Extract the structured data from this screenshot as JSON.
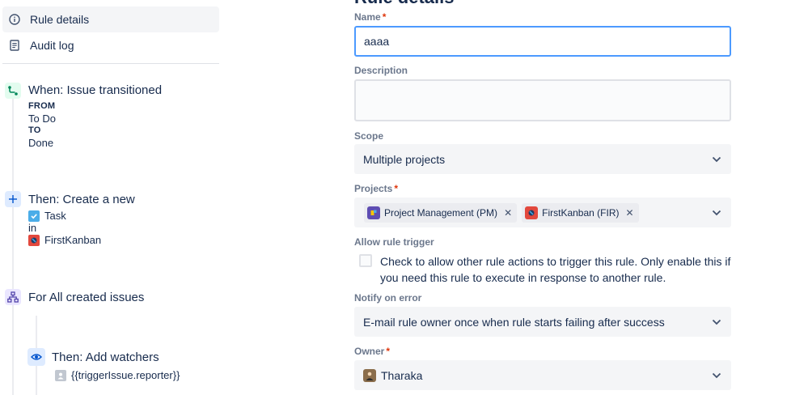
{
  "nav": {
    "items": [
      {
        "label": "Rule details",
        "icon": "info-icon",
        "active": true
      },
      {
        "label": "Audit log",
        "icon": "document-icon",
        "active": false
      }
    ]
  },
  "rule": {
    "trigger": {
      "title": "When: Issue transitioned",
      "from_label": "FROM",
      "from_value": "To Do",
      "to_label": "TO",
      "to_value": "Done",
      "icon": "transition-icon"
    },
    "create": {
      "title": "Then: Create a new",
      "issue_type": "Task",
      "connector": "in",
      "project": "FirstKanban",
      "icon": "plus-icon"
    },
    "branch": {
      "title": "For All created issues",
      "icon": "branch-icon"
    },
    "watchers": {
      "title": "Then: Add watchers",
      "value": "{{triggerIssue.reporter}}",
      "icon": "eye-icon"
    }
  },
  "form": {
    "heading": "Rule details",
    "name_label": "Name",
    "name_value": "aaaa",
    "required_mark": "*",
    "description_label": "Description",
    "description_value": "",
    "scope_label": "Scope",
    "scope_value": "Multiple projects",
    "projects_label": "Projects",
    "projects": [
      {
        "label": "Project Management (PM)",
        "color": "#5E4DB2"
      },
      {
        "label": "FirstKanban (FIR)",
        "color": "#E2483D"
      }
    ],
    "allow_trigger_label": "Allow rule trigger",
    "allow_trigger_text": "Check to allow other rule actions to trigger this rule. Only enable this if you need this rule to execute in response to another rule.",
    "allow_trigger_checked": false,
    "notify_label": "Notify on error",
    "notify_value": "E-mail rule owner once when rule starts failing after success",
    "owner_label": "Owner",
    "owner_value": "Tharaka"
  },
  "colors": {
    "accent": "#4C9AFF",
    "required": "#DE350B",
    "label": "#6B778C",
    "trigger_badge": "#E3FCEF",
    "action_badge": "#DEEBFF",
    "branch_badge": "#EAE6FF"
  }
}
